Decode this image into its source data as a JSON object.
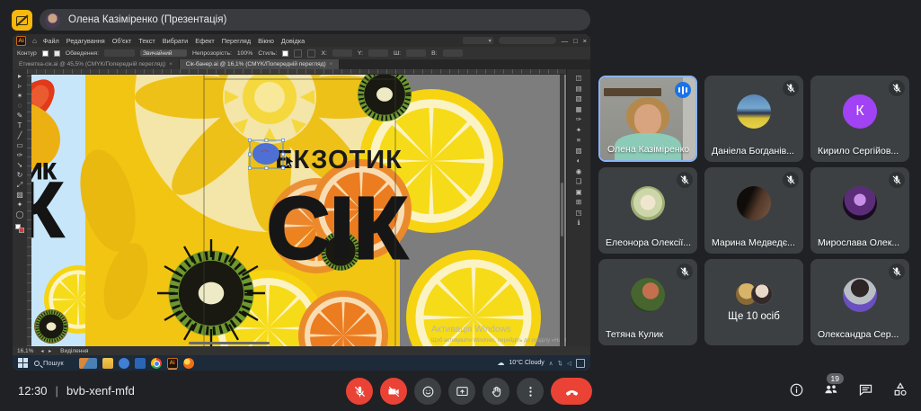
{
  "colors": {
    "accent": "#8ab4f8",
    "danger": "#ea4335",
    "speaking": "#1a73e8",
    "avatar_purple": "#a142f4"
  },
  "top_bar": {
    "presenter_label": "Олена Казіміренко (Презентація)"
  },
  "participants": [
    {
      "name": "Олена Казіміренко",
      "speaking": true,
      "video": true
    },
    {
      "name": "Даніела Богданів...",
      "muted": true
    },
    {
      "name": "Кирило Сергійов...",
      "muted": true,
      "initial": "К"
    },
    {
      "name": "Елеонора Олексії...",
      "muted": true
    },
    {
      "name": "Марина Медведє...",
      "muted": true
    },
    {
      "name": "Мирослава Олек...",
      "muted": true
    },
    {
      "name": "Тетяна Кулик",
      "muted": true
    },
    {
      "name": "Ще 10 осіб",
      "overflow": true
    },
    {
      "name": "Олександра Сер...",
      "muted": true
    }
  ],
  "bottom_bar": {
    "time": "12:30",
    "separator": "|",
    "meeting_code": "bvb-xenf-mfd",
    "participants_badge": "19"
  },
  "illustrator": {
    "app_badge": "Ai",
    "menu_items": [
      "Файл",
      "Редагування",
      "Об'єкт",
      "Текст",
      "Вибрати",
      "Ефект",
      "Перегляд",
      "Вікно",
      "Довідка"
    ],
    "window_controls": {
      "minimize": "—",
      "maximize": "□",
      "close": "×"
    },
    "control_bar": {
      "selection_label": "Контур",
      "stroke_label": "Обведення:",
      "blend_mode": "Звичайний",
      "opacity_label": "Непрозорість:",
      "opacity_value": "100%",
      "style_label": "Стиль:",
      "x_label": "X:",
      "y_label": "Y:",
      "w_label": "Ш:",
      "h_label": "В:"
    },
    "tabs": [
      {
        "title": "Етикетка-сік.ai @ 45,5% (CMYK/Попередній перегляд)",
        "close": "×"
      },
      {
        "title": "Сік-банер.ai @ 16,1% (CMYK/Попередній перегляд)",
        "close": "×"
      }
    ],
    "status": {
      "zoom_level": "16,1%",
      "nav": "◂ ▸",
      "label": "Виділення"
    },
    "artwork": {
      "headline": "ЕКЗОТИК",
      "title": "СІК",
      "left_fragment_1": "ТИК",
      "left_fragment_2": "К"
    },
    "watermark": {
      "line1": "Активація Windows",
      "line2": "Щоб активувати Windows, перейдіть до розділу «Настройки»."
    }
  },
  "taskbar": {
    "search_label": "Пошук",
    "weather": "10°C Cloudy"
  }
}
